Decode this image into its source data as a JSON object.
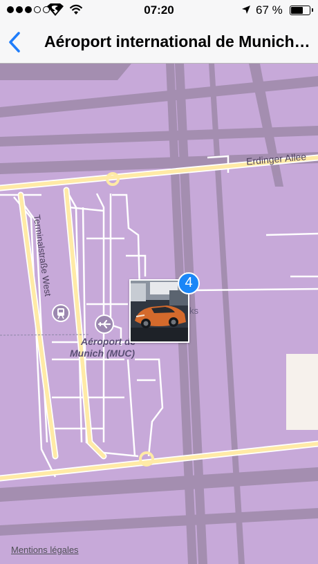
{
  "status_bar": {
    "signal_dots": 5,
    "signal_filled": 3,
    "carrier_icon": "superman-logo",
    "wifi_icon": "wifi-icon",
    "time": "07:20",
    "location_icon": "location-arrow-icon",
    "battery_percent_label": "67 %",
    "battery_level": 0.67
  },
  "nav": {
    "back_icon": "chevron-left-icon",
    "title": "Aéroport international de Munich (MUC)"
  },
  "map": {
    "road_labels": {
      "erdinger_allee": "Erdinger Allee",
      "terminalstrasse": "Terminalstraße West"
    },
    "poi": {
      "airport_line1": "Aéroport de",
      "airport_line2": "Munich (MUC)",
      "partial_label": "ks",
      "airport_icon": "airplane-icon",
      "train_icon": "train-icon"
    },
    "photo_cluster": {
      "count": "4",
      "photo_subject": "orange sports car"
    },
    "legal_link": "Mentions légales"
  },
  "colors": {
    "map_background": "#c7a9d9",
    "road_main": "#ffeaa6",
    "road_minor": "#ffffff",
    "road_band": "#9e8aaa",
    "badge": "#1a86f7",
    "nav_accent": "#1f7dfb"
  }
}
